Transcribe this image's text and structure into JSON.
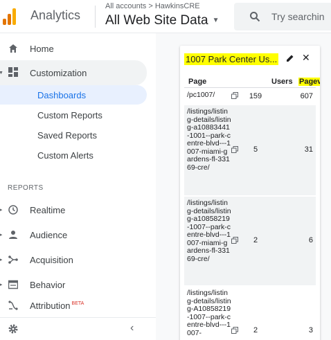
{
  "header": {
    "app_title": "Analytics",
    "account_breadcrumb": "All accounts > HawkinsCRE",
    "view_name": "All Web Site Data",
    "search_placeholder": "Try searchin",
    "logo_colors": [
      "#f9ab00",
      "#e37400",
      "#e37400"
    ]
  },
  "sidebar": {
    "home_label": "Home",
    "customization_label": "Customization",
    "customization_sub": [
      "Dashboards",
      "Custom Reports",
      "Saved Reports",
      "Custom Alerts"
    ],
    "active_sub": "Dashboards",
    "reports_heading": "REPORTS",
    "reports": [
      "Realtime",
      "Audience",
      "Acquisition",
      "Behavior",
      "Attribution"
    ],
    "attribution_badge": "BETA",
    "collapse_glyph": "‹"
  },
  "widget": {
    "title": "1007 Park Center Us...",
    "columns": {
      "page": "Page",
      "users": "Users",
      "pageviews": "Pageviews"
    },
    "rows": [
      {
        "page": "/pc1007/",
        "users": "159",
        "pageviews": "607"
      },
      {
        "page": "/listings/listing-details/listing-a10883441-1001--park-centre-blvd---1007-miami-gardens-fl-33169-cre/",
        "users": "5",
        "pageviews": "31"
      },
      {
        "page": "/listings/listing-details/listing-a10858219-1007--park-centre-blvd---1007-miami-gardens-fl-33169-cre/",
        "users": "2",
        "pageviews": "6"
      },
      {
        "page": "/listings/listing-details/listing-A10858219-1007--park-centre-blvd---1007-",
        "users": "2",
        "pageviews": "3"
      }
    ],
    "highlight_color": "#ffff00"
  },
  "colors": {
    "accent": "#1a73e8",
    "active_bg": "#e8f0fe",
    "selected_bg": "#f1f3f4"
  }
}
